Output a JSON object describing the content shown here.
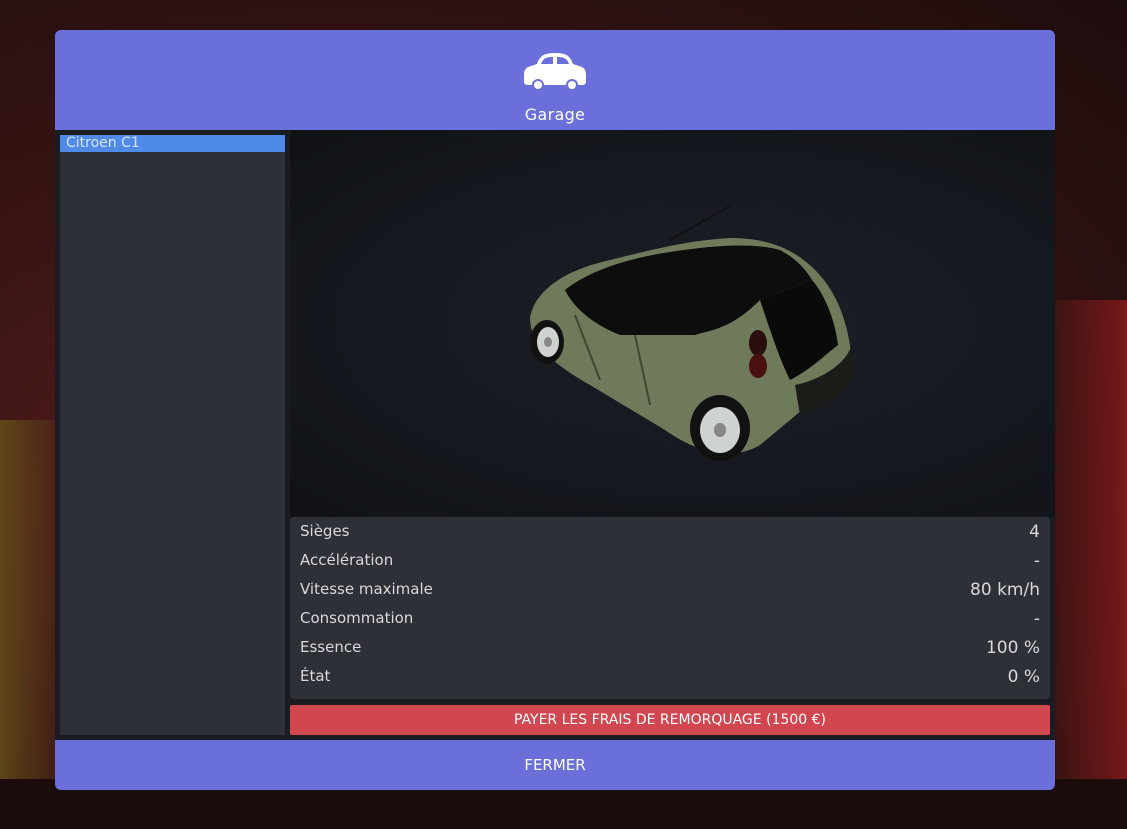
{
  "header": {
    "icon": "car-icon",
    "title": "Garage"
  },
  "vehicles": [
    {
      "name": "Citroen C1",
      "selected": true
    }
  ],
  "preview": {
    "car_color": "#6f7a5a"
  },
  "stats": [
    {
      "label": "Sièges",
      "value": "4"
    },
    {
      "label": "Accélération",
      "value": "-"
    },
    {
      "label": "Vitesse maximale",
      "value": "80 km/h"
    },
    {
      "label": "Consommation",
      "value": "-"
    },
    {
      "label": "Essence",
      "value": "100 %"
    },
    {
      "label": "État",
      "value": "0 %"
    }
  ],
  "actions": {
    "pay_towing_label": "PAYER LES FRAIS DE REMORQUAGE (1500 €)",
    "close_label": "FERMER"
  },
  "colors": {
    "accent": "#6a6fd9",
    "danger": "#d2464f",
    "selected_item": "#4f8ae8",
    "panel": "#2e3038"
  }
}
